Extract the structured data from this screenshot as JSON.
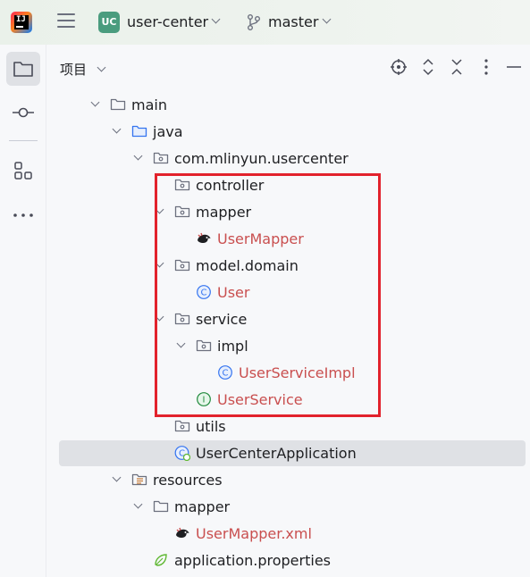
{
  "titlebar": {
    "project_badge": "UC",
    "project_name": "user-center",
    "branch": "master"
  },
  "panel": {
    "title": "项目"
  },
  "tree": [
    {
      "label": "main",
      "indent": 0,
      "expanded": true,
      "icon": "folder-icon",
      "error": false
    },
    {
      "label": "java",
      "indent": 1,
      "expanded": true,
      "icon": "source-folder-icon",
      "error": false
    },
    {
      "label": "com.mlinyun.usercenter",
      "indent": 2,
      "expanded": true,
      "icon": "package-icon",
      "error": false
    },
    {
      "label": "controller",
      "indent": 3,
      "expanded": null,
      "icon": "package-icon",
      "error": false
    },
    {
      "label": "mapper",
      "indent": 3,
      "expanded": true,
      "icon": "package-icon",
      "error": false
    },
    {
      "label": "UserMapper",
      "indent": 4,
      "expanded": null,
      "icon": "mybatis-icon",
      "error": true
    },
    {
      "label": "model.domain",
      "indent": 3,
      "expanded": true,
      "icon": "package-icon",
      "error": false
    },
    {
      "label": "User",
      "indent": 4,
      "expanded": null,
      "icon": "class-icon",
      "error": true
    },
    {
      "label": "service",
      "indent": 3,
      "expanded": true,
      "icon": "package-icon",
      "error": false
    },
    {
      "label": "impl",
      "indent": 4,
      "expanded": true,
      "icon": "package-icon",
      "error": false
    },
    {
      "label": "UserServiceImpl",
      "indent": 5,
      "expanded": null,
      "icon": "class-icon",
      "error": true
    },
    {
      "label": "UserService",
      "indent": 4,
      "expanded": null,
      "icon": "interface-icon",
      "error": true
    },
    {
      "label": "utils",
      "indent": 3,
      "expanded": null,
      "icon": "package-icon",
      "error": false
    },
    {
      "label": "UserCenterApplication",
      "indent": 3,
      "expanded": null,
      "icon": "spring-class-icon",
      "error": false,
      "selected": true
    },
    {
      "label": "resources",
      "indent": 1,
      "expanded": true,
      "icon": "resources-folder-icon",
      "error": false
    },
    {
      "label": "mapper",
      "indent": 2,
      "expanded": true,
      "icon": "folder-icon",
      "error": false
    },
    {
      "label": "UserMapper.xml",
      "indent": 3,
      "expanded": null,
      "icon": "mybatis-icon",
      "error": true
    },
    {
      "label": "application.properties",
      "indent": 2,
      "expanded": null,
      "icon": "spring-properties-icon",
      "error": false
    }
  ]
}
